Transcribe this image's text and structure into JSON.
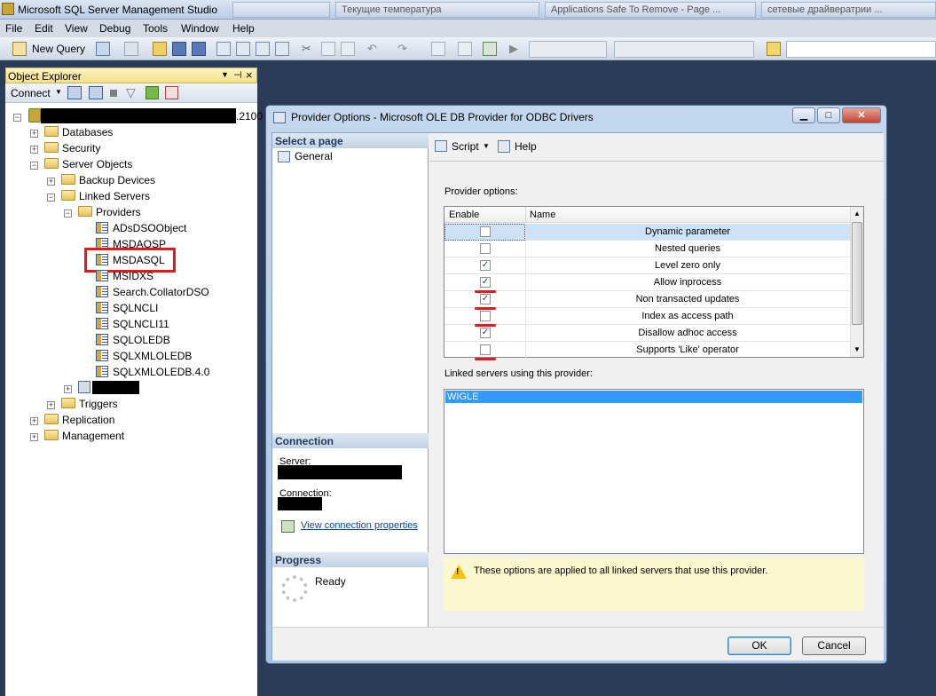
{
  "app": {
    "title": "Microsoft SQL Server Management Studio",
    "taskbar_tabs": [
      "",
      "Текущие температура",
      "Applications Safe To Remove - Page ...",
      "сетевые драйвератрии ..."
    ]
  },
  "menu": [
    "File",
    "Edit",
    "View",
    "Debug",
    "Tools",
    "Window",
    "Help"
  ],
  "toolbar": {
    "new_query": "New Query"
  },
  "object_explorer": {
    "title": "Object Explorer",
    "connect": "Connect",
    "server_suffix": ".2100",
    "nodes": {
      "databases": "Databases",
      "security": "Security",
      "server_objects": "Server Objects",
      "backup_devices": "Backup Devices",
      "linked_servers": "Linked Servers",
      "providers": "Providers",
      "triggers": "Triggers",
      "replication": "Replication",
      "management": "Management"
    },
    "providers": [
      "ADsDSOObject",
      "MSDAOSP",
      "MSDASQL",
      "MSIDXS",
      "Search.CollatorDSO",
      "SQLNCLI",
      "SQLNCLI11",
      "SQLOLEDB",
      "SQLXMLOLEDB",
      "SQLXMLOLEDB.4.0"
    ]
  },
  "dialog": {
    "title": "Provider Options - Microsoft OLE DB Provider for ODBC Drivers",
    "select_page": "Select a page",
    "page_general": "General",
    "script": "Script",
    "help": "Help",
    "provider_options_label": "Provider options:",
    "col_enable": "Enable",
    "col_name": "Name",
    "options": [
      {
        "name": "Dynamic parameter",
        "checked": false
      },
      {
        "name": "Nested queries",
        "checked": false
      },
      {
        "name": "Level zero only",
        "checked": true
      },
      {
        "name": "Allow inprocess",
        "checked": true
      },
      {
        "name": "Non transacted updates",
        "checked": true
      },
      {
        "name": "Index as access path",
        "checked": false
      },
      {
        "name": "Disallow adhoc access",
        "checked": true
      },
      {
        "name": "Supports 'Like' operator",
        "checked": false
      }
    ],
    "linked_servers_label": "Linked servers using this provider:",
    "linked_servers": [
      "WIGLE"
    ],
    "connection_section": "Connection",
    "server_label": "Server:",
    "connection_label": "Connection:",
    "view_conn_props": "View connection properties",
    "progress_section": "Progress",
    "progress_status": "Ready",
    "warning": "These options are applied to all linked servers that use this provider.",
    "ok": "OK",
    "cancel": "Cancel"
  },
  "colors": {
    "accent_select": "#3399ff",
    "red_annotation": "#e01b1b",
    "warning_bg": "#fbf8d0"
  }
}
